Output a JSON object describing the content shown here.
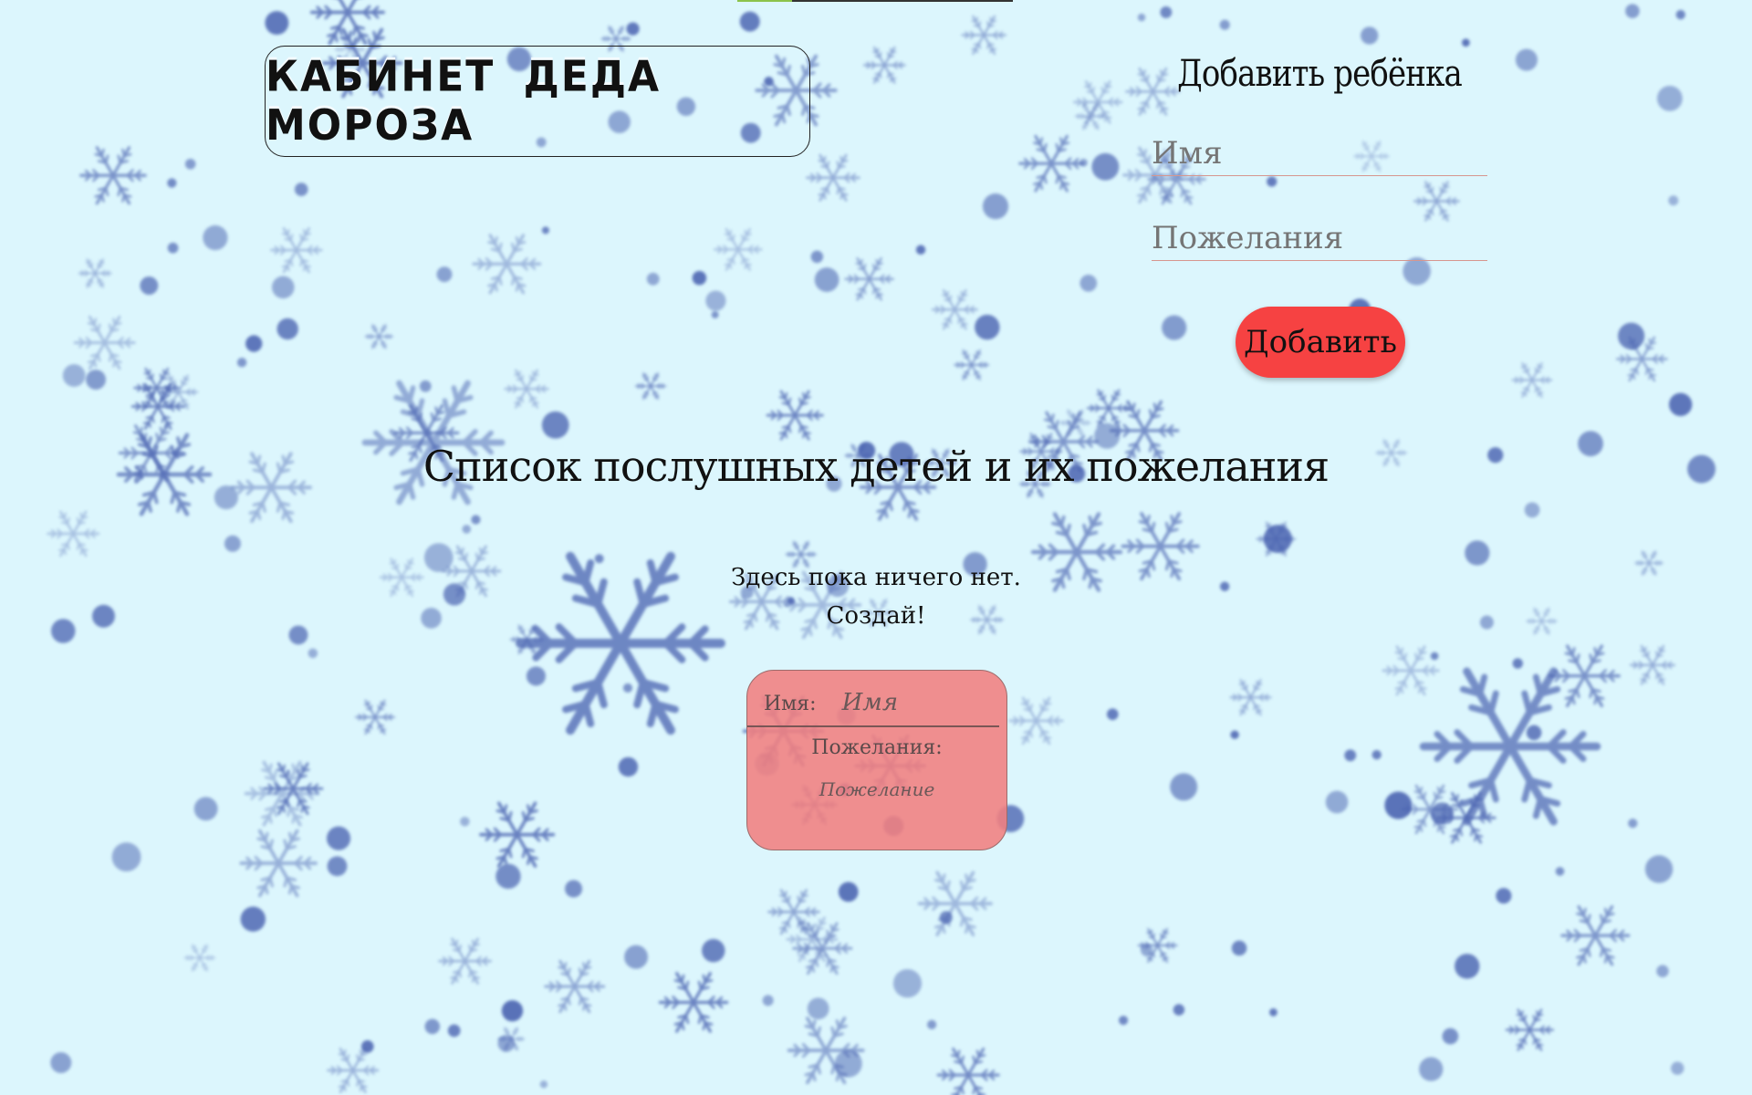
{
  "header": {
    "logo_text": "КАБИНЕТ ДЕДА МОРОЗА"
  },
  "add_child": {
    "title": "Добавить ребёнка",
    "name_placeholder": "Имя",
    "wishes_placeholder": "Пожелания",
    "submit_label": "Добавить"
  },
  "list": {
    "title": "Список послушных детей и их пожелания",
    "empty_line_1": "Здесь пока ничего нет.",
    "empty_line_2": "Создай!",
    "sample_card": {
      "name_label": "Имя:",
      "name_value": "Имя",
      "wishes_label": "Пожелания:",
      "wish_value": "Пожелание"
    }
  },
  "colors": {
    "background": "#dcf6fd",
    "snowflake": "#4a62b0",
    "add_button": "#f64242",
    "card": "#f18080"
  }
}
